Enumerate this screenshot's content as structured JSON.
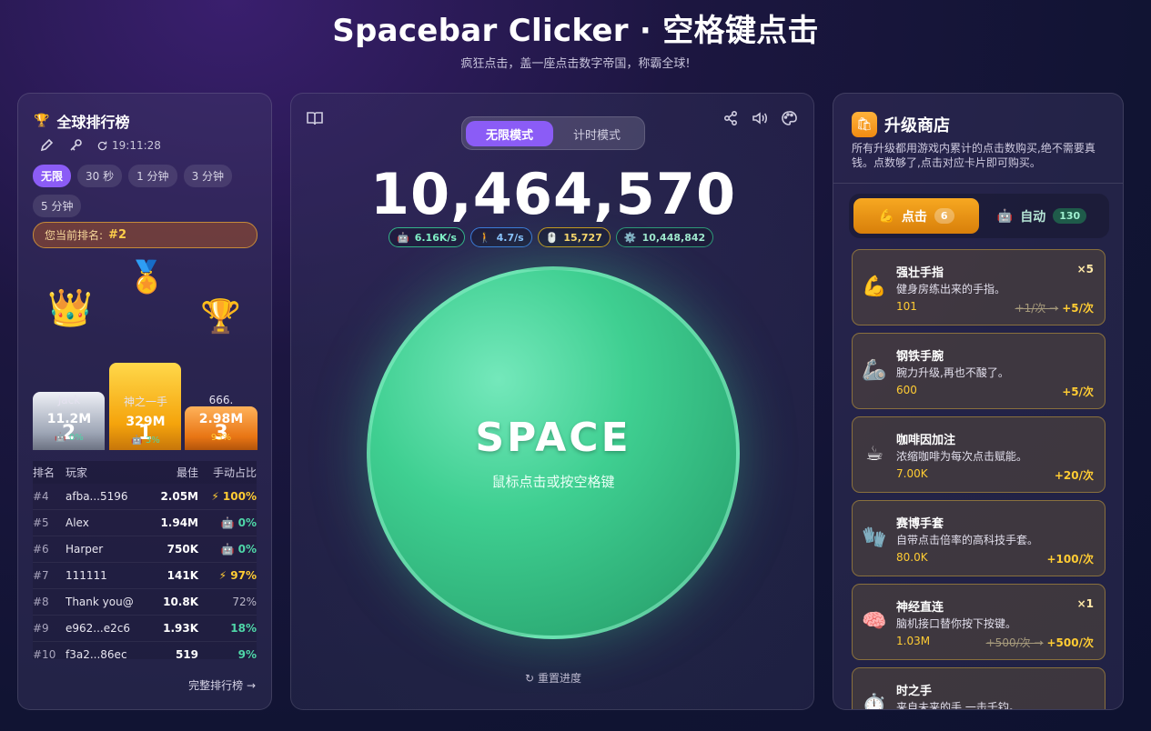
{
  "header": {
    "title": "Spacebar Clicker · 空格键点击",
    "subtitle": "疯狂点击，盖一座点击数字帝国，称霸全球!"
  },
  "leaderboard": {
    "title": "全球排行榜",
    "time": "19:11:28",
    "filters": [
      "无限",
      "30 秒",
      "1 分钟",
      "3 分钟",
      "5 分钟"
    ],
    "active_filter": "无限",
    "my_rank_label": "您当前排名:",
    "my_rank": "#2",
    "podium": [
      {
        "rank": "2",
        "name": "Jack",
        "score": "11.2M",
        "ratio": "0%"
      },
      {
        "rank": "1",
        "name": "神之一手",
        "score": "329M",
        "ratio": "3%"
      },
      {
        "rank": "3",
        "name": "666.",
        "score": "2.98M",
        "ratio": "93%"
      }
    ],
    "columns": [
      "排名",
      "玩家",
      "最佳",
      "手动占比"
    ],
    "rows": [
      {
        "rank": "#4",
        "player": "afba...5196",
        "best": "2.05M",
        "ratio": "⚡ 100%",
        "style": "gold"
      },
      {
        "rank": "#5",
        "player": "Alex",
        "best": "1.94M",
        "ratio": "🤖 0%",
        "style": "green"
      },
      {
        "rank": "#6",
        "player": "Harper",
        "best": "750K",
        "ratio": "🤖 0%",
        "style": "green"
      },
      {
        "rank": "#7",
        "player": "111111",
        "best": "141K",
        "ratio": "⚡ 97%",
        "style": "gold"
      },
      {
        "rank": "#8",
        "player": "Thank you@",
        "best": "10.8K",
        "ratio": "72%",
        "style": "grey"
      },
      {
        "rank": "#9",
        "player": "e962...e2c6",
        "best": "1.93K",
        "ratio": "18%",
        "style": "green"
      },
      {
        "rank": "#10",
        "player": "f3a2...86ec",
        "best": "519",
        "ratio": "9%",
        "style": "green"
      }
    ],
    "full_link": "完整排行榜 →"
  },
  "game": {
    "modes": [
      "无限模式",
      "计时模式"
    ],
    "active_mode": "无限模式",
    "score": "10,464,570",
    "stats": {
      "auto_rate": "6.16K/s",
      "click_rate": "4.7/s",
      "clicks": "15,727",
      "auto_total": "10,448,842"
    },
    "button_label": "SPACE",
    "button_hint": "鼠标点击或按空格键",
    "reset": "重置进度"
  },
  "shop": {
    "title": "升级商店",
    "description": "所有升级都用游戏内累计的点击数购买,绝不需要真钱。点数够了,点击对应卡片即可购买。",
    "tabs": [
      {
        "label": "点击",
        "count": "6"
      },
      {
        "label": "自动",
        "count": "130"
      }
    ],
    "items": [
      {
        "icon": "💪",
        "name": "强壮手指",
        "desc": "健身房练出来的手指。",
        "price": "101",
        "old": "+1/次 →",
        "gain": "+5/次",
        "owned": "×5"
      },
      {
        "icon": "🦾",
        "name": "钢铁手腕",
        "desc": "腕力升级,再也不酸了。",
        "price": "600",
        "old": "",
        "gain": "+5/次",
        "owned": ""
      },
      {
        "icon": "☕",
        "name": "咖啡因加注",
        "desc": "浓缩咖啡为每次点击赋能。",
        "price": "7.00K",
        "old": "",
        "gain": "+20/次",
        "owned": ""
      },
      {
        "icon": "🧤",
        "name": "赛博手套",
        "desc": "自带点击倍率的高科技手套。",
        "price": "80.0K",
        "old": "",
        "gain": "+100/次",
        "owned": ""
      },
      {
        "icon": "🧠",
        "name": "神经直连",
        "desc": "脑机接口替你按下按键。",
        "price": "1.03M",
        "old": "+500/次 →",
        "gain": "+500/次",
        "owned": "×1"
      },
      {
        "icon": "⏱️",
        "name": "时之手",
        "desc": "来自未来的手,一击千钧。",
        "price": "",
        "old": "",
        "gain": "",
        "owned": ""
      }
    ]
  }
}
